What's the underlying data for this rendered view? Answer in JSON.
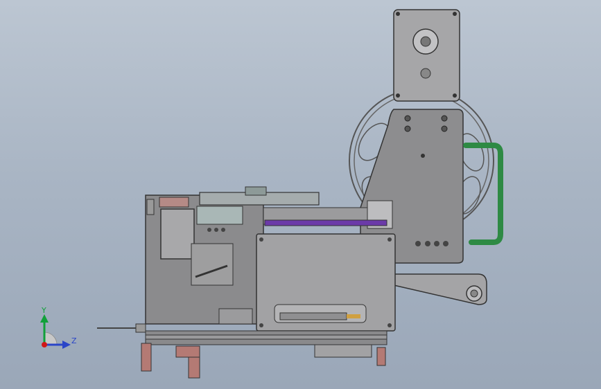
{
  "viewport": {
    "background_top": "#bcc6d2",
    "background_bottom": "#9aa7b8"
  },
  "triad": {
    "y_label": "Y",
    "z_label": "Z",
    "y_color": "#11a03a",
    "z_color": "#2a45c8",
    "origin_color": "#d01818"
  },
  "model": {
    "body_color": "#8d8d8f",
    "panel_color": "#a2a2a4",
    "purple_bar_color": "#6b3aa8",
    "green_handle_color": "#2e8a44",
    "copper_color": "#b47a74"
  }
}
